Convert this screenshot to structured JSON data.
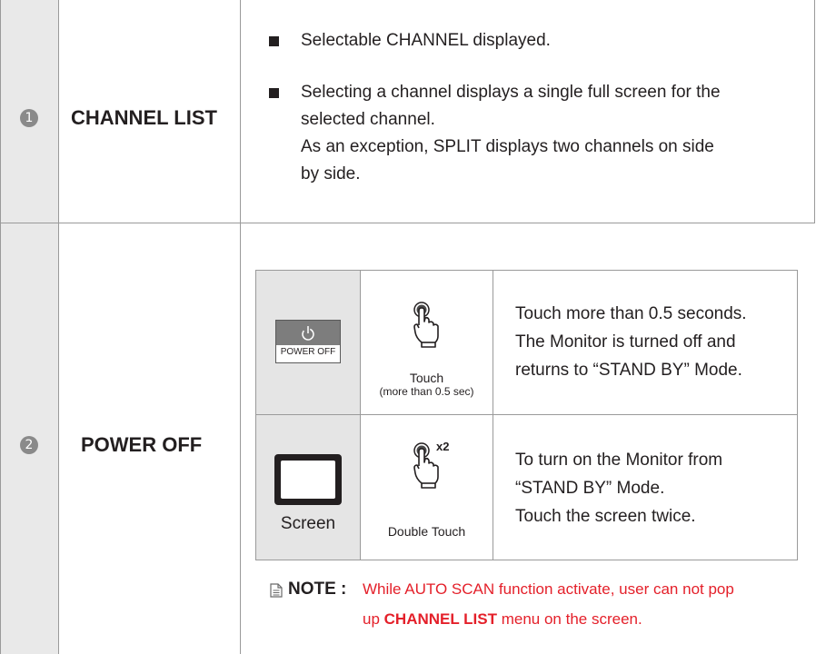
{
  "rows": [
    {
      "number": "1",
      "title": "CHANNEL LIST",
      "bullets": [
        "Selectable CHANNEL displayed.",
        "Selecting a channel displays a single full screen for the",
        "selected channel.",
        "As an exception, SPLIT displays two channels on side",
        "by side."
      ]
    },
    {
      "number": "2",
      "title": "POWER OFF",
      "table": [
        {
          "icon_label": "POWER OFF",
          "icon": "power-icon",
          "gesture_icon": "hand-touch-icon",
          "gesture_caption": "Touch",
          "gesture_caption_sub": "(more than 0.5 sec)",
          "description": [
            "Touch more than 0.5 seconds.",
            "The Monitor is turned off and",
            "returns to “STAND BY” Mode."
          ]
        },
        {
          "icon_label": "Screen",
          "icon": "monitor-screen-icon",
          "gesture_icon": "hand-double-touch-icon",
          "gesture_badge": "x2",
          "gesture_caption": "Double Touch",
          "description": [
            "To turn on the Monitor from",
            "“STAND BY” Mode.",
            "Touch the screen twice."
          ]
        }
      ],
      "note": {
        "label": "NOTE :",
        "line1": "While AUTO SCAN function activate, user can not pop",
        "line2_pre": "up ",
        "line2_bold": "CHANNEL LIST",
        "line2_post": " menu on the screen."
      }
    }
  ],
  "colors": {
    "number_column_bg": "#e9e9e9",
    "badge": "#8a8a8a",
    "border": "#9a9a9a",
    "note_red": "#e4202a"
  }
}
